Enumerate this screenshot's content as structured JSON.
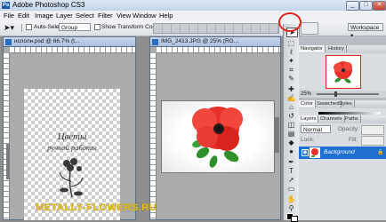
{
  "app": {
    "title": "Adobe Photoshop CS3",
    "logo": "Ps",
    "window_buttons": {
      "minimize": "_",
      "maximize": "□",
      "close": "✕"
    }
  },
  "menu": [
    "File",
    "Edit",
    "Image",
    "Layer",
    "Select",
    "Filter",
    "View",
    "Window",
    "Help"
  ],
  "options": {
    "auto_select_label": "Auto-Select:",
    "auto_select_value": "Group",
    "transform_label": "Show Transform Controls",
    "workspace_label": "Workspace ▾"
  },
  "documents": [
    {
      "title": "исполн.psd @ 66.7% (t...",
      "text_line1": "Цветы",
      "text_line2": "ручной работы"
    },
    {
      "title": "IMG_2413.JPG @ 25% (RG..."
    }
  ],
  "watermark": "METALLY-FLOWERS.RU",
  "panels": {
    "navigator_tabs": [
      "Navigator",
      "History"
    ],
    "zoom_value": "25%",
    "color_tabs": [
      "Color",
      "Swatches",
      "Styles"
    ],
    "layers_tabs": [
      "Layers",
      "Channels",
      "Paths"
    ],
    "blend_mode": "Normal",
    "opacity_label": "Opacity:",
    "lock_label": "Lock:",
    "fill_label": "Fill:",
    "layer_name": "Background"
  },
  "colors": {
    "highlight": "#e2231a",
    "selection": "#1f6fd1",
    "flower": "#e8302a",
    "leaf": "#2f8f2a",
    "watermark": "#e6c21a"
  }
}
